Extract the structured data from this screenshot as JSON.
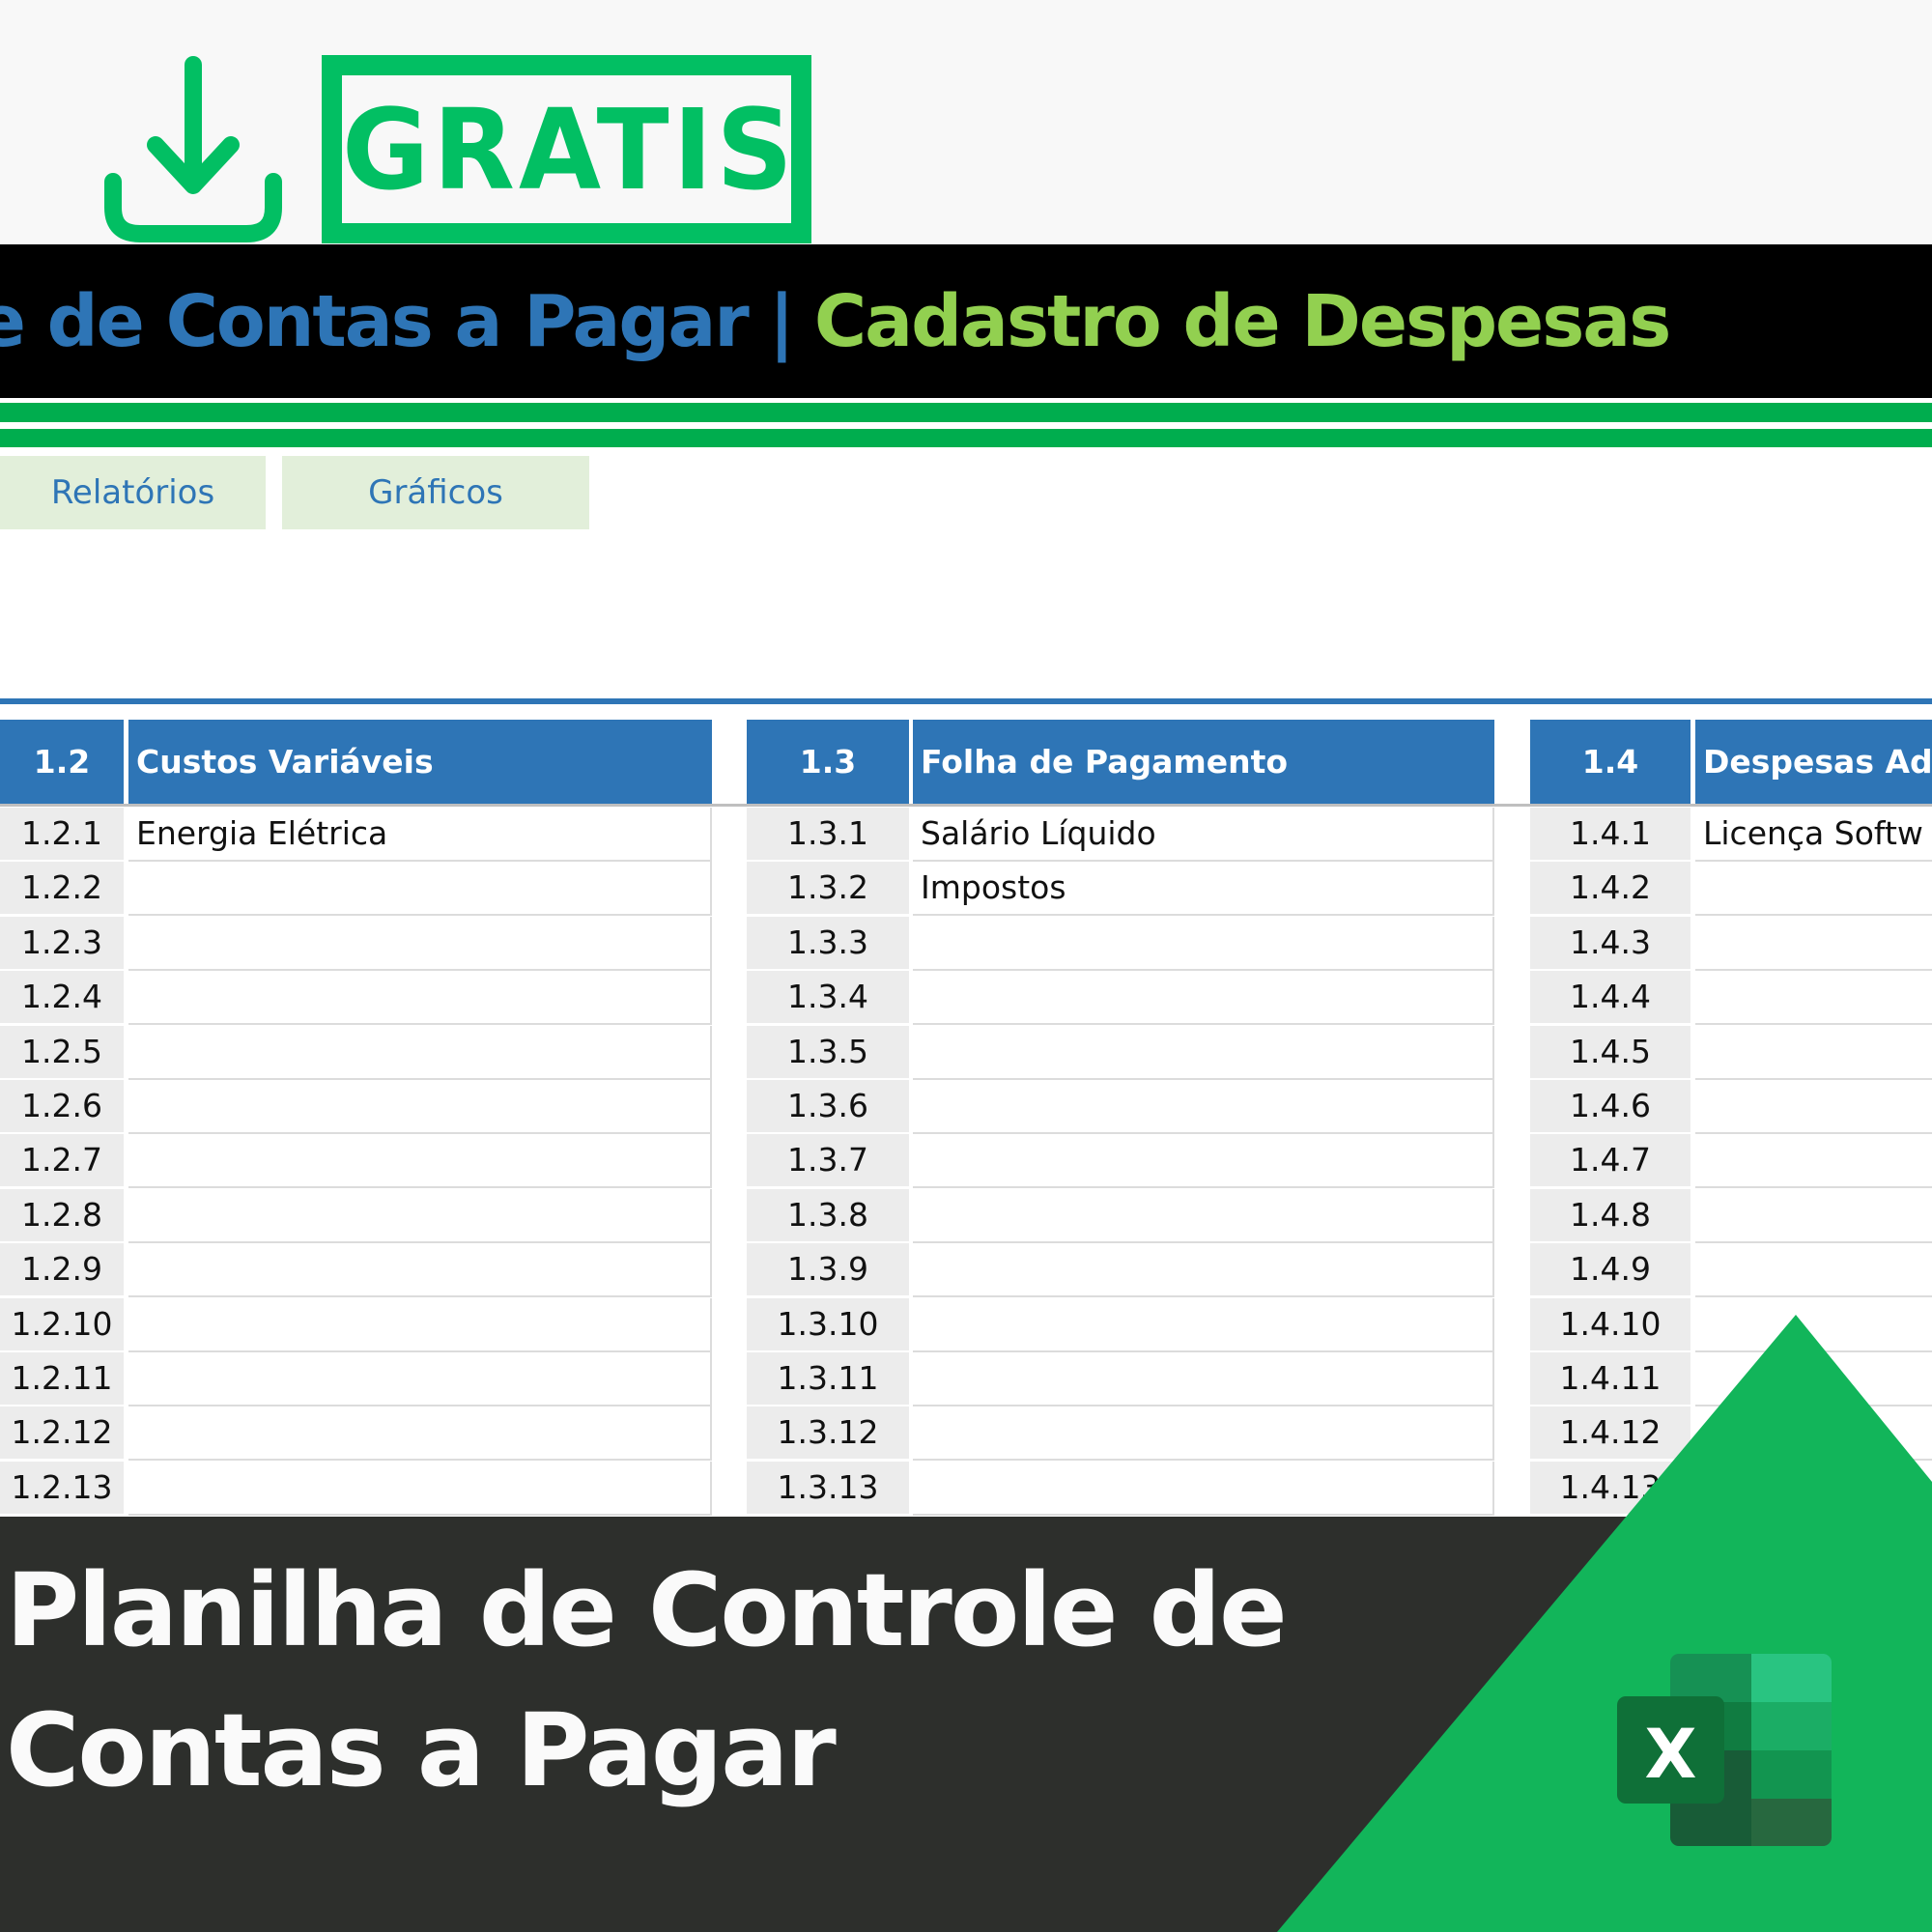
{
  "promo": {
    "badge_label": "GRATIS",
    "download_icon": "download-icon",
    "accent_color": "#02bf63"
  },
  "spreadsheet": {
    "title_main": "role de Contas a Pagar",
    "title_separator": "|",
    "title_sub": "Cadastro de Despesas",
    "tabs": [
      {
        "label": "Relatórios"
      },
      {
        "label": "Gráficos"
      }
    ],
    "blocks": [
      {
        "code": "1.2",
        "name": "Custos Variáveis",
        "rows": [
          {
            "code": "1.2.1",
            "name": "Energia Elétrica"
          },
          {
            "code": "1.2.2",
            "name": ""
          },
          {
            "code": "1.2.3",
            "name": ""
          },
          {
            "code": "1.2.4",
            "name": ""
          },
          {
            "code": "1.2.5",
            "name": ""
          },
          {
            "code": "1.2.6",
            "name": ""
          },
          {
            "code": "1.2.7",
            "name": ""
          },
          {
            "code": "1.2.8",
            "name": ""
          },
          {
            "code": "1.2.9",
            "name": ""
          },
          {
            "code": "1.2.10",
            "name": ""
          },
          {
            "code": "1.2.11",
            "name": ""
          },
          {
            "code": "1.2.12",
            "name": ""
          },
          {
            "code": "1.2.13",
            "name": ""
          }
        ]
      },
      {
        "code": "1.3",
        "name": "Folha de Pagamento",
        "rows": [
          {
            "code": "1.3.1",
            "name": "Salário Líquido"
          },
          {
            "code": "1.3.2",
            "name": "Impostos"
          },
          {
            "code": "1.3.3",
            "name": ""
          },
          {
            "code": "1.3.4",
            "name": ""
          },
          {
            "code": "1.3.5",
            "name": ""
          },
          {
            "code": "1.3.6",
            "name": ""
          },
          {
            "code": "1.3.7",
            "name": ""
          },
          {
            "code": "1.3.8",
            "name": ""
          },
          {
            "code": "1.3.9",
            "name": ""
          },
          {
            "code": "1.3.10",
            "name": ""
          },
          {
            "code": "1.3.11",
            "name": ""
          },
          {
            "code": "1.3.12",
            "name": ""
          },
          {
            "code": "1.3.13",
            "name": ""
          }
        ]
      },
      {
        "code": "1.4",
        "name": "Despesas Adm",
        "rows": [
          {
            "code": "1.4.1",
            "name": "Licença Softw"
          },
          {
            "code": "1.4.2",
            "name": ""
          },
          {
            "code": "1.4.3",
            "name": ""
          },
          {
            "code": "1.4.4",
            "name": ""
          },
          {
            "code": "1.4.5",
            "name": ""
          },
          {
            "code": "1.4.6",
            "name": ""
          },
          {
            "code": "1.4.7",
            "name": ""
          },
          {
            "code": "1.4.8",
            "name": ""
          },
          {
            "code": "1.4.9",
            "name": ""
          },
          {
            "code": "1.4.10",
            "name": ""
          },
          {
            "code": "1.4.11",
            "name": ""
          },
          {
            "code": "1.4.12",
            "name": ""
          },
          {
            "code": "1.4.13",
            "name": ""
          }
        ]
      }
    ]
  },
  "banner": {
    "line1": "Planilha de Controle de",
    "line2": "Contas a Pagar",
    "logo": "excel-logo",
    "logo_letter": "X"
  }
}
